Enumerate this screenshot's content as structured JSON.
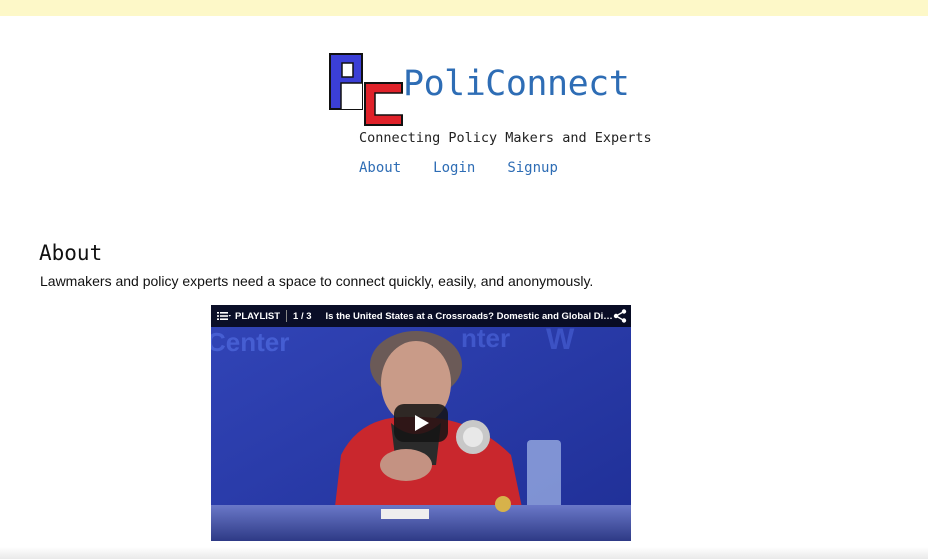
{
  "header": {
    "brand_name": "PoliConnect",
    "tagline": "Connecting Policy Makers and Experts",
    "logo_letters": "PC",
    "colors": {
      "brand": "#2e6db5",
      "logo_blue": "#3b3fd6",
      "logo_red": "#e0222a",
      "topbar": "#fdf8c8"
    }
  },
  "nav": {
    "items": [
      {
        "label": "About"
      },
      {
        "label": "Login"
      },
      {
        "label": "Signup"
      }
    ]
  },
  "about": {
    "title": "About",
    "text": "Lawmakers and policy experts need a space to connect quickly, easily, and anonymously."
  },
  "video": {
    "playlist_label": "PLAYLIST",
    "counter": "1 / 3",
    "title": "Is the United States at a Crossroads? Domestic and Global Dimen...",
    "icons": [
      "playlist-icon",
      "share-icon",
      "play-icon"
    ]
  }
}
